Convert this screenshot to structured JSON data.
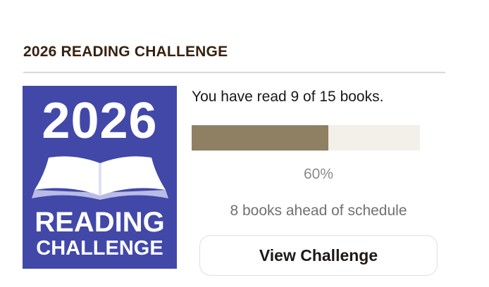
{
  "widget": {
    "title": "2026 READING CHALLENGE"
  },
  "badge": {
    "year": "2026",
    "line1": "READING",
    "line2": "CHALLENGE",
    "background_color": "#4148a8",
    "icon": "open-book-icon"
  },
  "progress": {
    "status_text": "You have read 9 of 15 books.",
    "books_read": 9,
    "books_goal": 15,
    "fraction": 0.6,
    "percent_label": "60%",
    "schedule_text": "8 books ahead of schedule",
    "fill_color": "#8f7f63",
    "track_color": "#f3efe9"
  },
  "actions": {
    "view_challenge_label": "View Challenge"
  }
}
